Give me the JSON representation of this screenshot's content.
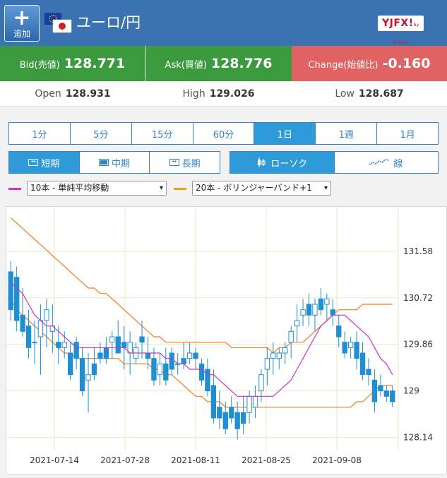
{
  "header": {
    "add_label": "追加",
    "title": "ユーロ/円",
    "logo_text": "YJFX!",
    "logo_sub": "by Yahoo!"
  },
  "prices": {
    "bid": {
      "label": "Bid(売値)",
      "value": "128.771"
    },
    "ask": {
      "label": "Ask(買値)",
      "value": "128.776"
    },
    "change": {
      "label": "Change(始値比)",
      "value": "-0.160"
    }
  },
  "ohl": {
    "open": {
      "label": "Open",
      "value": "128.931"
    },
    "high": {
      "label": "High",
      "value": "129.026"
    },
    "low": {
      "label": "Low",
      "value": "128.687"
    }
  },
  "colors": {
    "header": "#3a72b2",
    "bid": "#3b9a3d",
    "ask": "#3b9a3d",
    "change": "#e06262",
    "candle": "#1f8fd0",
    "ma": "#c934c9",
    "band": "#f07f1f"
  },
  "timeframes": [
    {
      "label": "1分"
    },
    {
      "label": "5分"
    },
    {
      "label": "15分"
    },
    {
      "label": "60分"
    },
    {
      "label": "1日",
      "active": true
    },
    {
      "label": "1週"
    },
    {
      "label": "1月"
    }
  ],
  "periods": [
    {
      "label": "短期",
      "active": true,
      "icon": "expand-icon"
    },
    {
      "label": "中期",
      "icon": "box-icon"
    },
    {
      "label": "長期",
      "icon": "compress-icon"
    }
  ],
  "chart_types": [
    {
      "label": "ローソク",
      "active": true,
      "icon": "candle-icon"
    },
    {
      "label": "線",
      "icon": "line-icon"
    }
  ],
  "indicators": {
    "ma": {
      "label": "10本 - 単純平均移動"
    },
    "band": {
      "label": "20本 - ボリンジャーバンド+1"
    }
  },
  "chart_data": {
    "type": "candlestick",
    "y_ticks": [
      131.58,
      130.72,
      129.86,
      129,
      128.14
    ],
    "ylim": [
      127.9,
      132.4
    ],
    "x_ticks": [
      "2021-07-14",
      "2021-07-28",
      "2021-08-11",
      "2021-08-25",
      "2021-09-08"
    ],
    "candles": [
      [
        131.2,
        131.4,
        130.3,
        130.5
      ],
      [
        131.1,
        131.3,
        130.1,
        130.3
      ],
      [
        130.4,
        130.9,
        130.0,
        130.1
      ],
      [
        130.2,
        130.5,
        129.6,
        129.8
      ],
      [
        129.9,
        130.3,
        129.5,
        129.9
      ],
      [
        130.0,
        130.6,
        129.3,
        130.3
      ],
      [
        130.3,
        130.7,
        129.8,
        130.5
      ],
      [
        130.1,
        130.6,
        129.7,
        130.2
      ],
      [
        129.9,
        130.2,
        129.5,
        129.8
      ],
      [
        129.8,
        130.1,
        129.6,
        129.9
      ],
      [
        129.7,
        129.9,
        129.2,
        129.3
      ],
      [
        129.9,
        130.0,
        129.4,
        129.6
      ],
      [
        129.6,
        129.8,
        128.9,
        129.0
      ],
      [
        129.2,
        129.7,
        128.6,
        129.3
      ],
      [
        129.5,
        129.8,
        129.2,
        129.3
      ],
      [
        129.7,
        129.9,
        129.5,
        129.6
      ],
      [
        129.8,
        130.0,
        129.5,
        129.6
      ],
      [
        129.9,
        130.1,
        129.6,
        130.0
      ],
      [
        130.0,
        130.3,
        129.7,
        129.7
      ],
      [
        129.9,
        130.2,
        129.4,
        129.8
      ],
      [
        129.7,
        130.1,
        129.3,
        129.9
      ],
      [
        129.6,
        129.9,
        129.5,
        129.8
      ],
      [
        130.0,
        130.3,
        129.6,
        129.9
      ],
      [
        129.7,
        130.0,
        129.4,
        129.6
      ],
      [
        129.6,
        129.8,
        129.1,
        129.2
      ],
      [
        129.3,
        129.7,
        129.1,
        129.5
      ],
      [
        129.5,
        129.8,
        129.1,
        129.2
      ],
      [
        129.7,
        129.8,
        129.3,
        129.4
      ],
      [
        129.5,
        129.7,
        129.3,
        129.5
      ],
      [
        129.6,
        129.9,
        129.4,
        129.5
      ],
      [
        129.6,
        129.9,
        129.5,
        129.7
      ],
      [
        129.7,
        129.8,
        129.4,
        129.6
      ],
      [
        129.5,
        129.6,
        129.1,
        129.2
      ],
      [
        129.4,
        129.6,
        128.9,
        129.0
      ],
      [
        129.1,
        129.4,
        128.4,
        128.5
      ],
      [
        128.7,
        129.0,
        128.3,
        128.5
      ],
      [
        128.6,
        128.8,
        128.2,
        128.3
      ],
      [
        128.7,
        128.9,
        128.4,
        128.5
      ],
      [
        128.6,
        128.8,
        128.1,
        128.3
      ],
      [
        128.6,
        128.9,
        128.2,
        128.4
      ],
      [
        128.6,
        129.0,
        128.4,
        128.9
      ],
      [
        128.7,
        129.1,
        128.5,
        128.9
      ],
      [
        129.0,
        129.4,
        128.8,
        129.3
      ],
      [
        129.4,
        129.8,
        129.1,
        129.6
      ],
      [
        129.6,
        129.9,
        129.3,
        129.7
      ],
      [
        129.6,
        129.8,
        129.4,
        129.7
      ],
      [
        129.7,
        129.9,
        129.5,
        129.8
      ],
      [
        129.9,
        130.2,
        129.6,
        130.1
      ],
      [
        130.2,
        130.6,
        129.9,
        130.3
      ],
      [
        130.4,
        130.7,
        130.2,
        130.5
      ],
      [
        130.6,
        130.8,
        130.2,
        130.4
      ],
      [
        130.4,
        130.7,
        130.1,
        130.6
      ],
      [
        130.7,
        130.9,
        130.4,
        130.5
      ],
      [
        130.6,
        130.8,
        130.3,
        130.7
      ],
      [
        130.5,
        130.7,
        130.2,
        130.4
      ],
      [
        130.2,
        130.4,
        129.8,
        130.0
      ],
      [
        129.9,
        130.1,
        129.6,
        129.7
      ],
      [
        129.8,
        130.0,
        129.6,
        129.9
      ],
      [
        129.9,
        130.1,
        129.4,
        129.6
      ],
      [
        129.7,
        129.9,
        129.2,
        129.3
      ],
      [
        129.4,
        129.6,
        129.1,
        129.3
      ],
      [
        129.2,
        129.4,
        128.6,
        128.8
      ],
      [
        129.1,
        129.3,
        128.9,
        129.0
      ],
      [
        129.0,
        129.1,
        128.8,
        128.9
      ],
      [
        129.0,
        129.1,
        128.7,
        128.8
      ]
    ],
    "ma": [
      131.0,
      130.9,
      130.8,
      130.6,
      130.4,
      130.3,
      130.2,
      130.2,
      130.1,
      130.0,
      129.9,
      129.8,
      129.8,
      129.8,
      129.8,
      129.8,
      129.8,
      129.8,
      129.8,
      129.8,
      129.7,
      129.7,
      129.7,
      129.7,
      129.7,
      129.7,
      129.6,
      129.6,
      129.5,
      129.5,
      129.4,
      129.4,
      129.4,
      129.3,
      129.3,
      129.2,
      129.1,
      129.0,
      128.9,
      128.9,
      128.9,
      128.9,
      128.9,
      128.9,
      128.9,
      129.0,
      129.1,
      129.2,
      129.4,
      129.6,
      129.8,
      130.0,
      130.2,
      130.3,
      130.4,
      130.4,
      130.4,
      130.3,
      130.2,
      130.1,
      130.0,
      129.8,
      129.6,
      129.5,
      129.3
    ],
    "band_upper": [
      132.2,
      132.1,
      132.0,
      131.9,
      131.8,
      131.7,
      131.6,
      131.5,
      131.4,
      131.3,
      131.2,
      131.1,
      131.0,
      130.9,
      130.9,
      130.8,
      130.8,
      130.7,
      130.6,
      130.5,
      130.4,
      130.3,
      130.2,
      130.1,
      130.0,
      130.0,
      129.9,
      129.9,
      129.9,
      129.9,
      129.9,
      129.9,
      129.9,
      129.9,
      129.9,
      129.9,
      129.9,
      129.8,
      129.8,
      129.8,
      129.8,
      129.8,
      129.8,
      129.8,
      129.7,
      129.8,
      129.8,
      129.9,
      129.9,
      129.9,
      130.0,
      130.1,
      130.2,
      130.3,
      130.4,
      130.5,
      130.5,
      130.5,
      130.5,
      130.6,
      130.6,
      130.6,
      130.6,
      130.6,
      130.6
    ],
    "band_lower": [
      130.7,
      130.5,
      130.4,
      130.3,
      130.2,
      130.1,
      130.0,
      129.9,
      129.8,
      129.7,
      129.7,
      129.6,
      129.6,
      129.6,
      129.6,
      129.6,
      129.6,
      129.6,
      129.6,
      129.5,
      129.5,
      129.5,
      129.5,
      129.5,
      129.4,
      129.4,
      129.3,
      129.3,
      129.2,
      129.1,
      129.0,
      128.9,
      128.9,
      128.8,
      128.8,
      128.8,
      128.7,
      128.7,
      128.7,
      128.7,
      128.7,
      128.7,
      128.7,
      128.7,
      128.7,
      128.7,
      128.7,
      128.7,
      128.7,
      128.7,
      128.7,
      128.7,
      128.7,
      128.7,
      128.7,
      128.7,
      128.7,
      128.7,
      128.8,
      128.8,
      128.9,
      129.0,
      129.1,
      129.1,
      129.1
    ]
  }
}
